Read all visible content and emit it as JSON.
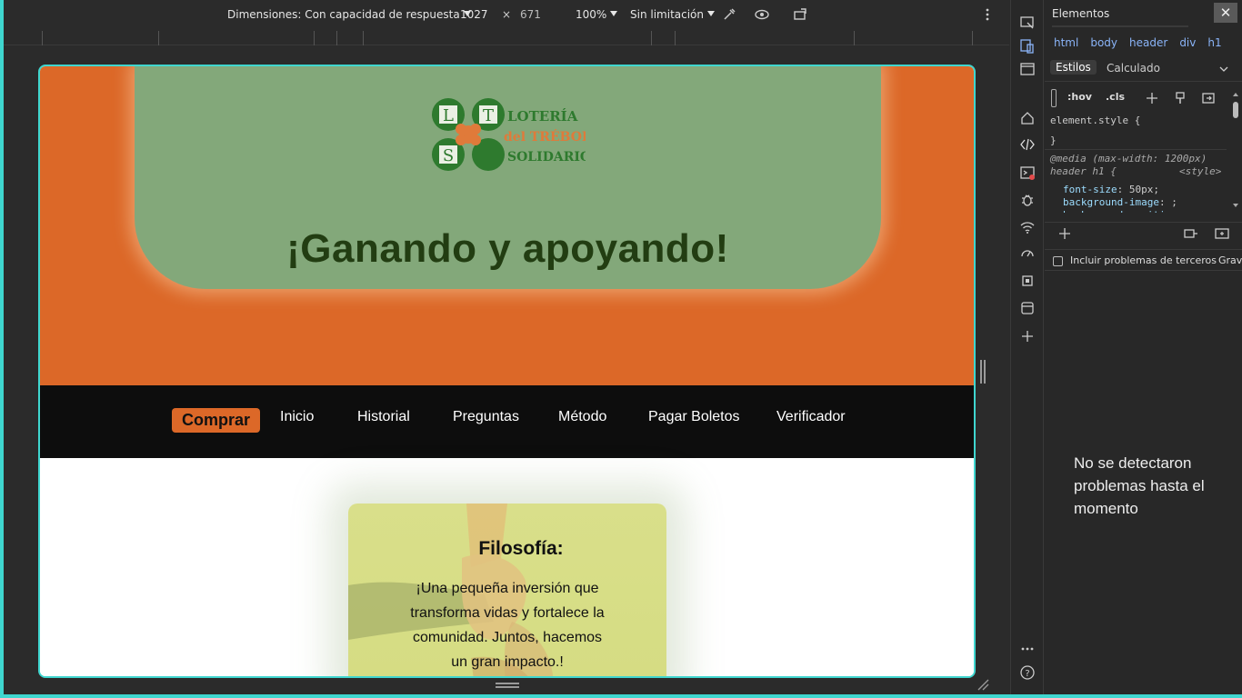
{
  "device_toolbar": {
    "dimensions_label": "Dimensiones: Con capacidad de respuesta",
    "width_value": "1027",
    "height_value": "671",
    "zoom": "100%",
    "throttling": "Sin limitación"
  },
  "site": {
    "logo_letters": [
      "L",
      "T",
      "S"
    ],
    "logo_text_lines": [
      "LOTERÍA",
      "del TRÉBOL",
      "SOLIDARIO"
    ],
    "title": "¡Ganando y apoyando!",
    "nav": {
      "buy": "Comprar",
      "links": [
        "Inicio",
        "Historial",
        "Preguntas",
        "Método",
        "Pagar Boletos",
        "Verificador"
      ]
    },
    "philosophy": {
      "title": "Filosofía:",
      "text": "¡Una pequeña inversión que transforma vidas y fortalece la comunidad. Juntos, hacemos un gran impacto.!"
    }
  },
  "devtools": {
    "panel_title": "Elementos",
    "breadcrumbs": [
      "html",
      "body",
      "header",
      "div",
      "h1"
    ],
    "tabs": [
      "Estilos",
      "Calculado"
    ],
    "filter_tools": [
      ":hov",
      ".cls"
    ],
    "styles": {
      "element_style": "element.style {",
      "element_close": "}",
      "media_query": "@media (max-width: 1200px)",
      "selector": "header h1 {",
      "source": "<style>",
      "props": [
        {
          "name": "font-size",
          "value": "50px;"
        },
        {
          "name": "background-image",
          "value": ";"
        },
        {
          "name": "background-position-x",
          "value": ""
        }
      ]
    },
    "third_party_label": "Incluir problemas de terceros",
    "third_party_suffix": "Grav",
    "no_issues": "No se detectaron problemas hasta el momento"
  },
  "colors": {
    "header_orange": "#dc6828",
    "header_green": "#83a87a",
    "title_green": "#223d12",
    "nav_black": "#0d0d0d",
    "card_yellow": "#d9df8a",
    "viewport_border": "#3fd6cf"
  }
}
